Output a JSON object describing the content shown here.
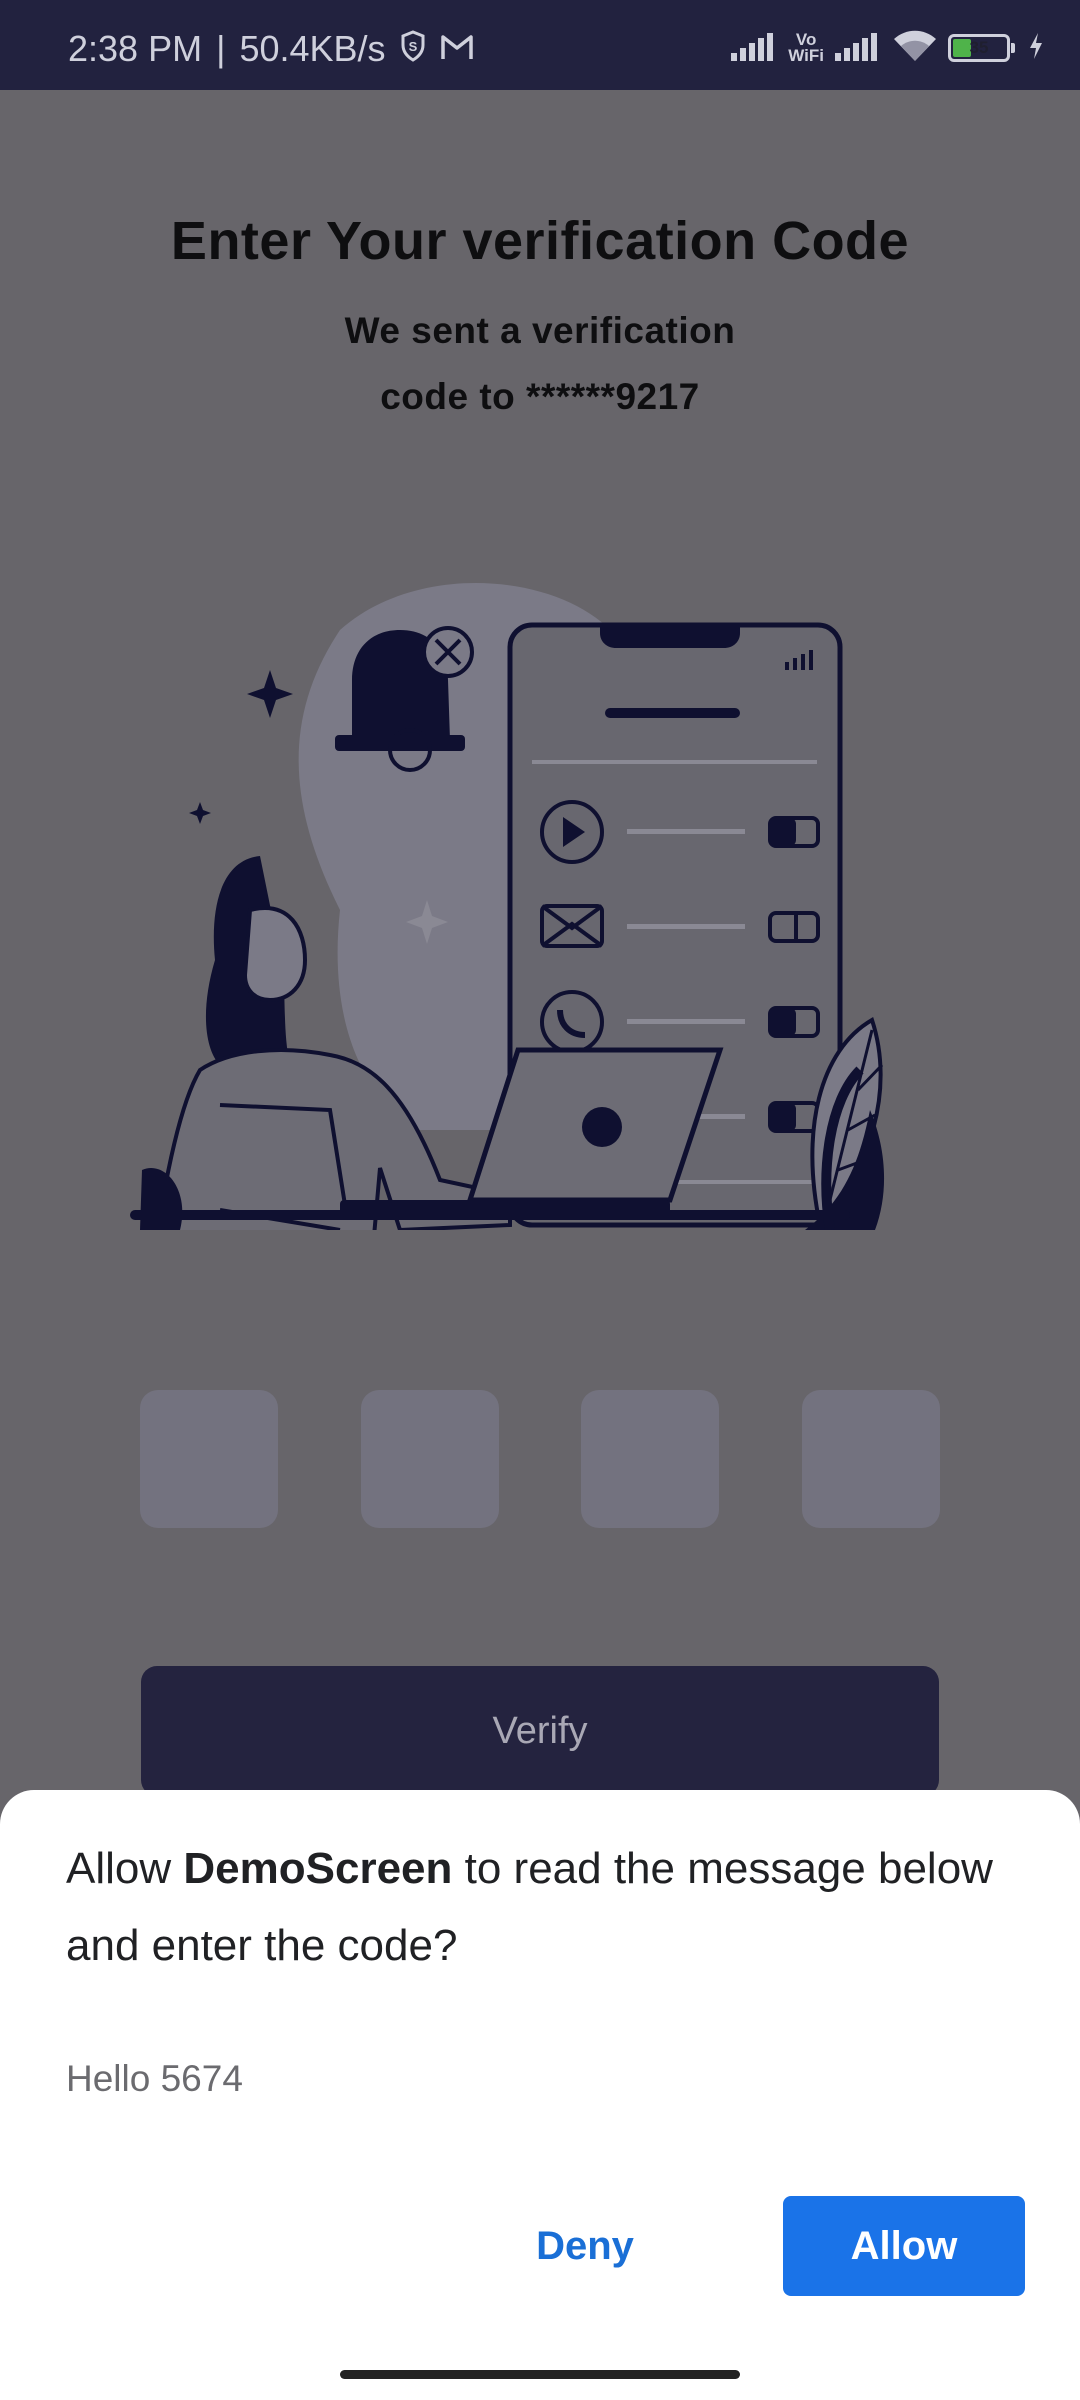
{
  "status_bar": {
    "time": "2:38 PM",
    "separator": "|",
    "speed": "50.4KB/s",
    "vowifi_line1": "Vo",
    "vowifi_line2": "WiFi",
    "battery_level": "35",
    "icons": [
      "shield-s-icon",
      "gmail-icon",
      "signal-icon",
      "vowifi-icon",
      "signal-icon",
      "wifi-icon",
      "battery-icon",
      "charging-bolt-icon"
    ]
  },
  "page": {
    "title": "Enter Your verification Code",
    "subtitle": "We sent a verification code to ******9217",
    "otp_values": [
      "",
      "",
      "",
      ""
    ],
    "verify_label": "Verify"
  },
  "dialog": {
    "title_prefix": "Allow ",
    "app_name": "DemoScreen",
    "title_suffix": " to read the message below and enter the code?",
    "message": "Hello 5674",
    "deny_label": "Deny",
    "allow_label": "Allow"
  },
  "colors": {
    "status_bar_bg": "#22223f",
    "scrim_bg": "#67656a",
    "verify_bg": "#24233f",
    "allow_bg": "#1a73e8",
    "deny_text": "#1a6fd6"
  }
}
